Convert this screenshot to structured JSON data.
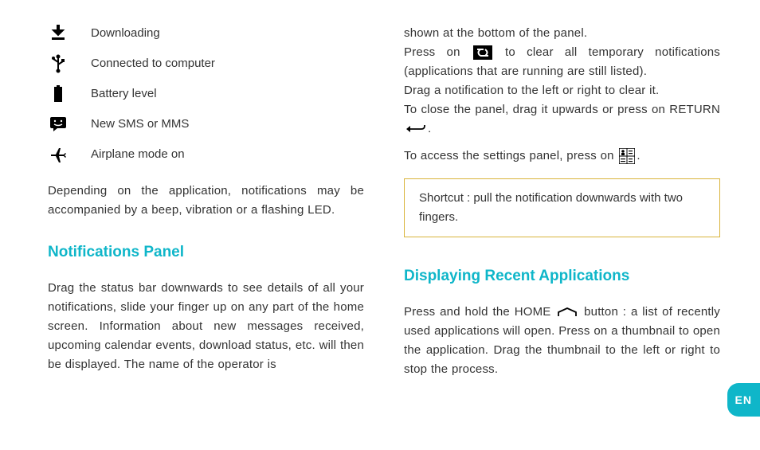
{
  "icons": [
    {
      "label": "Downloading",
      "name": "download-icon"
    },
    {
      "label": "Connected to computer",
      "name": "usb-icon"
    },
    {
      "label": "Battery level",
      "name": "battery-icon"
    },
    {
      "label": "New SMS or MMS",
      "name": "sms-icon"
    },
    {
      "label": "Airplane mode on",
      "name": "airplane-icon"
    }
  ],
  "left": {
    "intro": "Depending on the application, notifications may be accompanied by a beep, vibration or a flashing LED.",
    "heading1": "Notifications Panel",
    "panel_text": "Drag the status bar downwards to see details of all your notifications, slide your finger up on any part of the home screen. Information about new messages received, upcoming calendar events, download status, etc. will then be displayed. The name of the operator is"
  },
  "right": {
    "line1": "shown at the bottom of the panel.",
    "line2a": "Press on",
    "line2b": "to clear all temporary notifications (applications that are running are still listed).",
    "line3": "Drag a notification to the left or right to clear it.",
    "line4a": "To close the panel, drag it upwards or press on RETURN",
    "line4b": ".",
    "line5a": "To access the settings panel, press on",
    "line5b": ".",
    "tip": "Shortcut : pull the notification downwards with two fingers.",
    "heading2": "Displaying Recent Applications",
    "recent_a": "Press and hold the HOME",
    "recent_b": "button : a list of recently used applications will open. Press on a thumbnail to open the application. Drag the thumbnail to the left or right to stop the process."
  },
  "lang": "EN"
}
